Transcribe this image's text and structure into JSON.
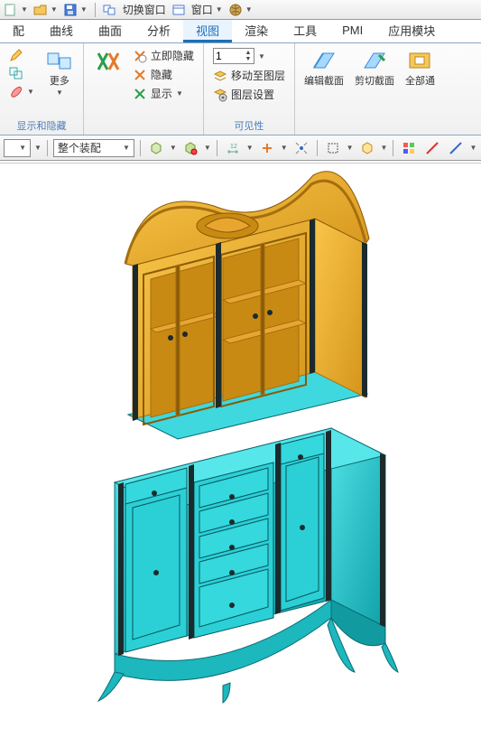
{
  "colors": {
    "accent": "#1d6fb8",
    "model_top": "#f3b12e",
    "model_top_shadow": "#c98a13",
    "model_base": "#29c8cf",
    "model_base_shadow": "#0d8f97",
    "model_dark": "#1b2a2c"
  },
  "qat": {
    "switch_window": "切换窗口",
    "window": "窗口"
  },
  "menu": {
    "items": [
      "配",
      "曲线",
      "曲面",
      "分析",
      "视图",
      "渲染",
      "工具",
      "PMI",
      "应用模块"
    ],
    "active_index": 4
  },
  "ribbon": {
    "group1": {
      "more_label": "更多"
    },
    "group2": {
      "title": "显示和隐藏"
    },
    "group3": {
      "immediate_hide": "立即隐藏",
      "hide": "隐藏",
      "show": "显示"
    },
    "group4": {
      "move_to_layer": "移动至图层",
      "layer_settings": "图层设置",
      "layer_value": "1",
      "title": "可见性"
    },
    "group5": {
      "edit_section": "编辑截面",
      "clip_section": "剪切截面",
      "all_through": "全部通"
    }
  },
  "toolbar2": {
    "left_combo": "",
    "assembly": "整个装配"
  }
}
